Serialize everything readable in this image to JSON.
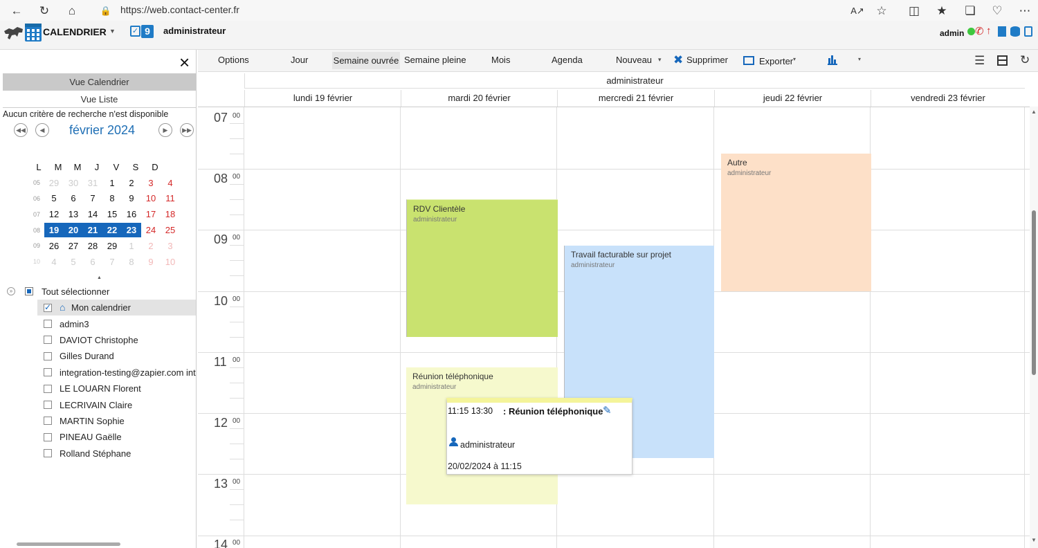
{
  "browser": {
    "url": "https://web.contact-center.fr"
  },
  "appbar": {
    "app_name": "CALENDRIER",
    "task_count": "9",
    "user": "administrateur",
    "right_user": "admin"
  },
  "sidebar": {
    "view_calendar": "Vue Calendrier",
    "view_list": "Vue Liste",
    "no_criteria": "Aucun critère de recherche n'est disponible",
    "month_title": "février 2024",
    "weekday_headers": [
      "L",
      "M",
      "M",
      "J",
      "V",
      "S",
      "D"
    ],
    "weeks": [
      {
        "num": "05",
        "days": [
          "29",
          "30",
          "31",
          "1",
          "2",
          "3",
          "4"
        ]
      },
      {
        "num": "06",
        "days": [
          "5",
          "6",
          "7",
          "8",
          "9",
          "10",
          "11"
        ]
      },
      {
        "num": "07",
        "days": [
          "12",
          "13",
          "14",
          "15",
          "16",
          "17",
          "18"
        ]
      },
      {
        "num": "08",
        "days": [
          "19",
          "20",
          "21",
          "22",
          "23",
          "24",
          "25"
        ]
      },
      {
        "num": "09",
        "days": [
          "26",
          "27",
          "28",
          "29",
          "1",
          "2",
          "3"
        ]
      },
      {
        "num": "10",
        "days": [
          "4",
          "5",
          "6",
          "7",
          "8",
          "9",
          "10"
        ]
      }
    ],
    "select_all": "Tout sélectionner",
    "calendars": [
      {
        "label": "Mon calendrier",
        "checked": true
      },
      {
        "label": "admin3",
        "checked": false
      },
      {
        "label": "DAVIOT Christophe",
        "checked": false
      },
      {
        "label": "Gilles Durand",
        "checked": false
      },
      {
        "label": "integration-testing@zapier.com inte",
        "checked": false
      },
      {
        "label": "LE LOUARN Florent",
        "checked": false
      },
      {
        "label": "LECRIVAIN Claire",
        "checked": false
      },
      {
        "label": "MARTIN Sophie",
        "checked": false
      },
      {
        "label": "PINEAU Gaëlle",
        "checked": false
      },
      {
        "label": "Rolland Stéphane",
        "checked": false
      }
    ]
  },
  "toolbar": {
    "options": "Options",
    "jour": "Jour",
    "semaine_ouvree": "Semaine ouvrée",
    "semaine_pleine": "Semaine pleine",
    "mois": "Mois",
    "agenda": "Agenda",
    "nouveau": "Nouveau",
    "supprimer": "Supprimer",
    "exporter": "Exporter"
  },
  "calendar": {
    "owner": "administrateur",
    "days": [
      "lundi 19 février",
      "mardi 20 février",
      "mercredi 21 février",
      "jeudi 22 février",
      "vendredi 23 février"
    ],
    "hours": [
      "07",
      "08",
      "09",
      "10",
      "11",
      "12",
      "13",
      "14"
    ],
    "minutes_label": "00",
    "events": [
      {
        "title": "RDV Clientèle",
        "owner": "administrateur",
        "color": "#c9e26f"
      },
      {
        "title": "Travail facturable sur projet",
        "owner": "administrateur",
        "color": "#c8e1fa"
      },
      {
        "title": "Autre",
        "owner": "administrateur",
        "color": "#fde0c8"
      },
      {
        "title": "Réunion téléphonique",
        "owner": "administrateur",
        "color": "#f6f9cd"
      }
    ],
    "popup": {
      "time": "11:15 13:30",
      "title": ": Réunion téléphonique",
      "user": "administrateur",
      "date": "20/02/2024 à 11:15"
    }
  },
  "colors": {
    "accent": "#1667bb",
    "weekend": "#d42828"
  }
}
